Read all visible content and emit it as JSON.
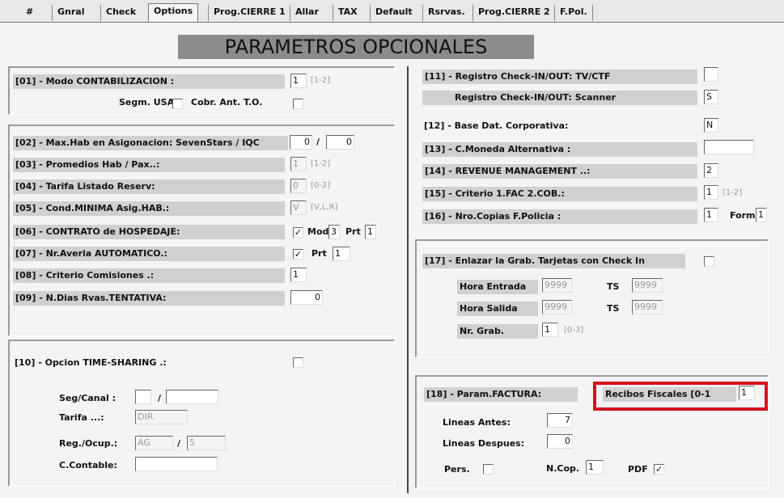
{
  "tabs": [
    {
      "label": "#"
    },
    {
      "label": "Gnral"
    },
    {
      "label": "Check"
    },
    {
      "label": "Options"
    },
    {
      "label": "Prog.CIERRE 1"
    },
    {
      "label": "Allar"
    },
    {
      "label": "TAX"
    },
    {
      "label": "Default"
    },
    {
      "label": "Rsrvas."
    },
    {
      "label": "Prog.CIERRE 2"
    },
    {
      "label": "F.Pol."
    }
  ],
  "title": "PARAMETROS OPCIONALES",
  "left": {
    "p01": {
      "label": "[01] - Modo CONTABILIZACION :",
      "value": "1",
      "hint": "[1-2]",
      "segm_label": "Segm. USA",
      "cobr_label": "Cobr. Ant. T.O."
    },
    "p02": {
      "label": "[02] - Max.Hab en Asigonacion: SevenStars / IQC",
      "value1": "0",
      "sep": "/",
      "value2": "0"
    },
    "p03": {
      "label": "[03] - Promedios Hab / Pax..:",
      "value": "1",
      "hint": "[1-2]"
    },
    "p04": {
      "label": "[04] - Tarifa Listado Reserv:",
      "value": "0",
      "hint": "[0-2]"
    },
    "p05": {
      "label": "[05] - Cond.MINIMA Asig.HAB.:",
      "value": "V",
      "hint": "[V,L,R]"
    },
    "p06": {
      "label": "[06] - CONTRATO de HOSPEDAJE:",
      "check": "✓",
      "mod_label": "Mod",
      "mod_value": "3",
      "prt_label": "Prt",
      "prt_value": "1"
    },
    "p07": {
      "label": "[07] - Nr.Averia AUTOMATICO.:",
      "check": "✓",
      "prt_label": "Prt",
      "prt_value": "1"
    },
    "p08": {
      "label": "[08] - Criterio Comisiones .:",
      "value": "1"
    },
    "p09": {
      "label": "[09] - N.Dias Rvas.TENTATIVA:",
      "value": "0"
    },
    "p10": {
      "label": "[10] - Opcion TIME-SHARING .:",
      "segcanal_label": "Seg/Canal :",
      "segcanal_sep": "/",
      "tarifa_label": "Tarifa ...:",
      "tarifa_value": "DIR",
      "regocup_label": "Reg./Ocup.:",
      "regocup_value1": "AG",
      "regocup_sep": "/",
      "regocup_value2": "5",
      "ccontable_label": "C.Contable:"
    }
  },
  "right": {
    "p11": {
      "label": "[11] - Registro Check-IN/OUT: TV/CTF",
      "scanner_label": "Registro Check-IN/OUT: Scanner",
      "scanner_value": "S"
    },
    "p12": {
      "label": "[12] - Base Dat. Corporativa:",
      "value": "N"
    },
    "p13": {
      "label": "[13] - C.Moneda Alternativa :"
    },
    "p14": {
      "label": "[14] - REVENUE MANAGEMENT ..:",
      "value": "2"
    },
    "p15": {
      "label": "[15] - Criterio 1.FAC 2.COB.:",
      "value": "1",
      "hint": "[1-2]"
    },
    "p16": {
      "label": "[16] - Nro.Copias F.Policia :",
      "value": "1",
      "form_label": "Form",
      "form_value": "1"
    },
    "p17": {
      "label": "[17] - Enlazar la Grab. Tarjetas con Check In",
      "hora_entrada_label": "Hora Entrada",
      "hora_entrada_value": "9999",
      "ts1_label": "TS",
      "ts1_value": "9999",
      "hora_salida_label": "Hora Salida",
      "hora_salida_value": "9999",
      "ts2_label": "TS",
      "ts2_value": "9999",
      "nrgrab_label": "Nr. Grab.",
      "nrgrab_value": "1",
      "nrgrab_hint": "[0-3]"
    },
    "p18": {
      "label": "[18] - Param.FACTURA:",
      "recibos_label": "Recibos Fiscales [0-1",
      "recibos_value": "1",
      "lineas_antes_label": "Lineas Antes:",
      "lineas_antes_value": "7",
      "lineas_despues_label": "Lineas Despues:",
      "lineas_despues_value": "0",
      "pers_label": "Pers.",
      "ncop_label": "N.Cop.",
      "ncop_value": "1",
      "pdf_label": "PDF",
      "pdf_check": "✓"
    }
  },
  "colors": {
    "highlight": "#d4111d",
    "title_bg": "#8c8c8c",
    "label_bg": "#d0d0d0"
  }
}
